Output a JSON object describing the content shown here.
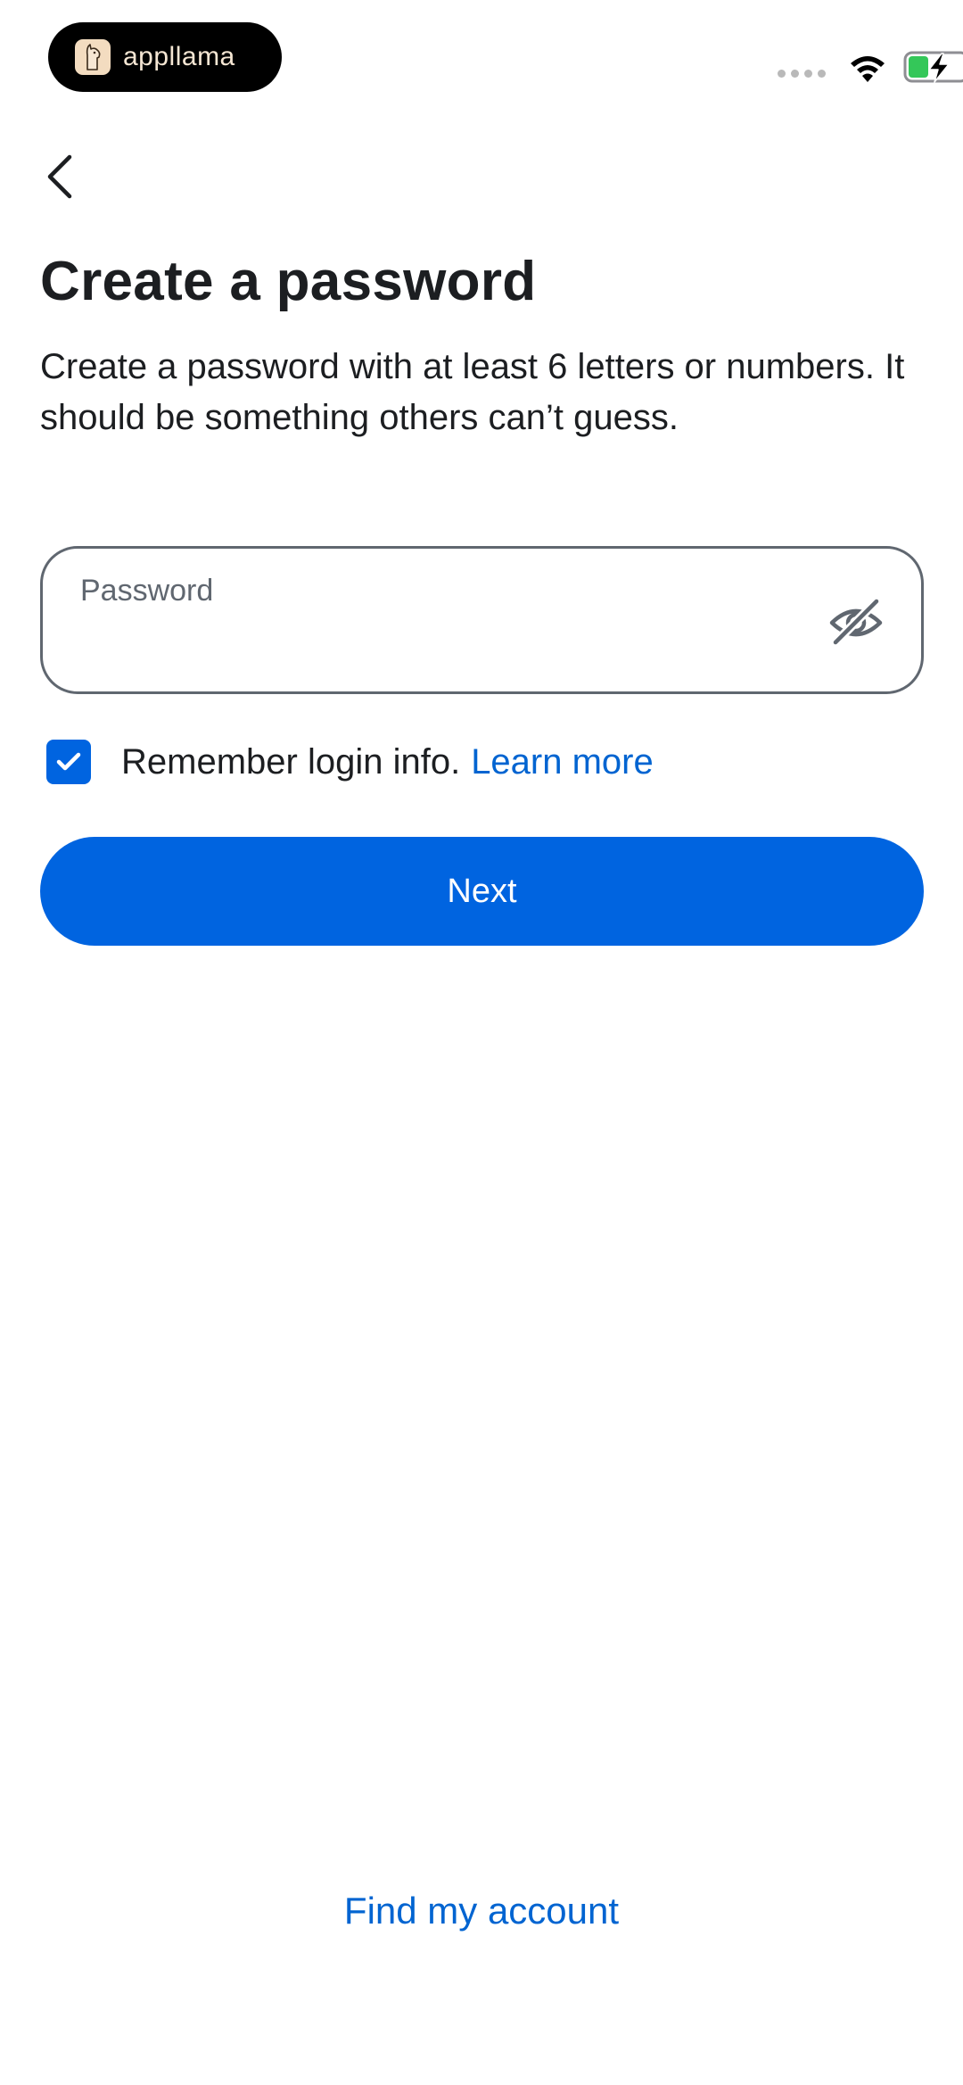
{
  "status_bar": {
    "brand_name": "appllama",
    "brand_icon": "llama-logo-icon",
    "wifi_icon": "wifi-icon",
    "battery_icon": "battery-charging-icon"
  },
  "nav": {
    "back_icon": "chevron-left-icon"
  },
  "header": {
    "title": "Create a password",
    "description": "Create a password with at least 6 letters or numbers. It should be something others can’t guess."
  },
  "password_field": {
    "label": "Password",
    "value": "",
    "visibility_icon": "eye-off-icon"
  },
  "remember": {
    "checked": true,
    "label": "Remember login info.",
    "link": "Learn more"
  },
  "actions": {
    "next_label": "Next",
    "find_account": "Find my account"
  },
  "colors": {
    "primary": "#0064e0",
    "link": "#0064d1",
    "text": "#1c1e21",
    "muted": "#606770",
    "battery_fill": "#34c759"
  }
}
